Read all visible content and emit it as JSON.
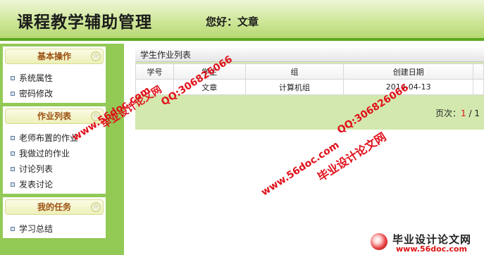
{
  "header": {
    "title": "课程教学辅助管理",
    "greeting_label": "您好：",
    "user_name": "文章"
  },
  "sidebar": {
    "groups": [
      {
        "title": "基本操作",
        "items": [
          "系统属性",
          "密码修改"
        ]
      },
      {
        "title": "作业列表",
        "items": [
          "老师布置的作业",
          "我做过的作业",
          "讨论列表",
          "发表讨论"
        ]
      },
      {
        "title": "我的任务",
        "items": [
          "学习总结"
        ]
      }
    ],
    "toggle_glyph": "☆"
  },
  "main": {
    "list_title": "学生作业列表",
    "columns": [
      "学号",
      "学生",
      "组",
      "创建日期",
      ""
    ],
    "rows": [
      [
        "",
        "文章",
        "计算机组",
        "2014-04-13",
        ""
      ]
    ],
    "pager": {
      "label": "页次：",
      "current": "1",
      "separator": " / ",
      "total": "1"
    }
  },
  "watermarks": {
    "url": "www.56doc.com",
    "qq": "QQ:306826066",
    "site_name": "毕业设计论文网",
    "logo_name": "毕业设计论文网",
    "logo_url": "www.56doc.com"
  },
  "colors": {
    "header_border": "#5aa91f",
    "sidebar_bg": "#93c955",
    "content_bg": "#d3e8ae",
    "menu_head_text": "#9b4f10",
    "watermark_red": "#e0101a"
  }
}
